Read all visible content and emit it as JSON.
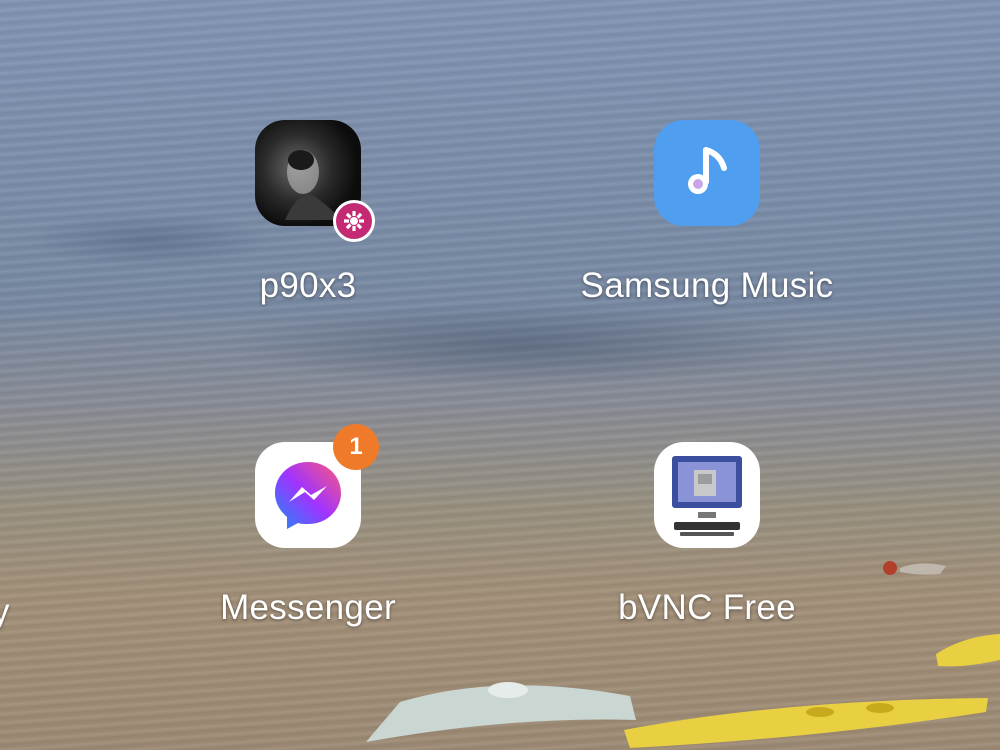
{
  "apps": [
    {
      "id": "p90x3",
      "label": "p90x3"
    },
    {
      "id": "samsung-music",
      "label": "Samsung Music"
    },
    {
      "id": "messenger",
      "label": "Messenger",
      "badge": "1"
    },
    {
      "id": "bvnc-free",
      "label": "bVNC Free"
    }
  ],
  "partial_label": "y",
  "colors": {
    "samsung_music_bg": "#4f9ef0",
    "badge": "#ef7a2a",
    "work_badge": "#c42a74"
  }
}
